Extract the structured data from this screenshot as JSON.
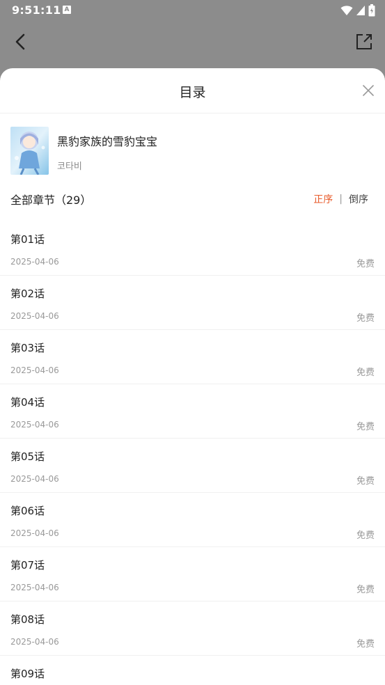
{
  "status_bar": {
    "time": "9:51:11",
    "a_icon": "A"
  },
  "top_bar": {
    "back_icon": "chevron-left-icon",
    "share_icon": "share-icon"
  },
  "sheet": {
    "title": "目录",
    "book": {
      "title": "黑豹家族的雪豹宝宝",
      "author": "코타비"
    },
    "chapters_label": "全部章节（29）",
    "order": {
      "asc": "正序",
      "separator": "|",
      "desc": "倒序",
      "active": "asc"
    },
    "chapters": [
      {
        "name": "第01话",
        "date": "2025-04-06",
        "price": "免费"
      },
      {
        "name": "第02话",
        "date": "2025-04-06",
        "price": "免费"
      },
      {
        "name": "第03话",
        "date": "2025-04-06",
        "price": "免费"
      },
      {
        "name": "第04话",
        "date": "2025-04-06",
        "price": "免费"
      },
      {
        "name": "第05话",
        "date": "2025-04-06",
        "price": "免费"
      },
      {
        "name": "第06话",
        "date": "2025-04-06",
        "price": "免费"
      },
      {
        "name": "第07话",
        "date": "2025-04-06",
        "price": "免费"
      },
      {
        "name": "第08话",
        "date": "2025-04-06",
        "price": "免费"
      },
      {
        "name": "第09话",
        "date": "",
        "price": ""
      }
    ]
  },
  "colors": {
    "accent": "#e85c2c",
    "overlay": "#8c8c8c"
  }
}
